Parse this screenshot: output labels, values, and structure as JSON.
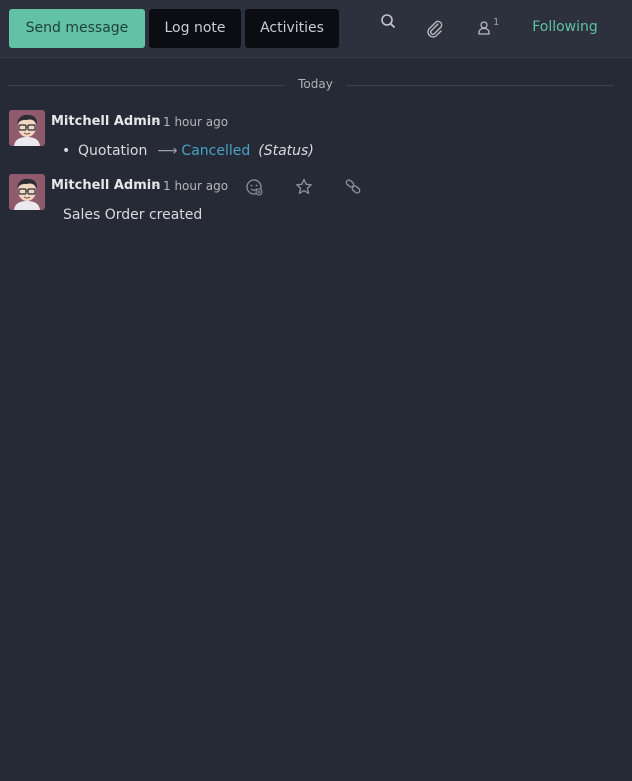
{
  "toolbar": {
    "send_message": "Send message",
    "log_note": "Log note",
    "activities": "Activities",
    "follower_count": "1",
    "following": "Following"
  },
  "separator": {
    "label": "Today"
  },
  "messages": [
    {
      "author": "Mitchell Admin",
      "dash": "-",
      "time": "1 hour ago",
      "tracking": {
        "old_value": "Quotation",
        "new_value": "Cancelled",
        "field": "(Status)"
      }
    },
    {
      "author": "Mitchell Admin",
      "dash": "-",
      "time": "1 hour ago",
      "body": "Sales Order created"
    }
  ],
  "colors": {
    "accent": "#61c2a4",
    "link": "#46a4c4",
    "background": "#262a36"
  },
  "icons": [
    "search-icon",
    "paperclip-icon",
    "user-icon",
    "add-reaction-icon",
    "star-icon",
    "link-icon"
  ]
}
